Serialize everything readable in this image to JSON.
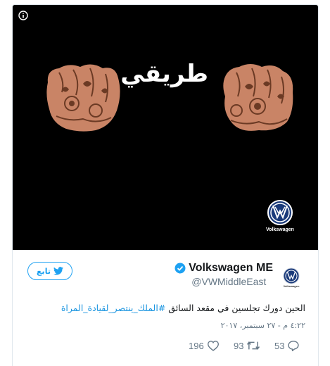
{
  "media": {
    "headline": "طريقي",
    "brand_logo_text": "Volkswagen"
  },
  "tweet": {
    "follow_label": "تابع",
    "display_name": "Volkswagen ME",
    "handle": "@VWMiddleEast",
    "avatar_caption": "Volkswagen",
    "text_plain": "الحين دورك تجلسين في مقعد السائق ",
    "hashtag": "#الملك_ينتصر_لقيادة_المراة",
    "timestamp": "٤:٢٢ م - ٢٧ سبتمبر، ٢٠١٧",
    "likes": "196",
    "retweets": "93",
    "replies": "53"
  },
  "colors": {
    "accent": "#1da1f2",
    "verified": "#1da1f2",
    "link": "#1b95e0",
    "muted": "#657786"
  },
  "icons": [
    "info-icon",
    "twitter-bird-icon",
    "verified-badge-icon",
    "volkswagen-logo-icon",
    "heart-icon",
    "retweet-icon",
    "reply-icon"
  ]
}
